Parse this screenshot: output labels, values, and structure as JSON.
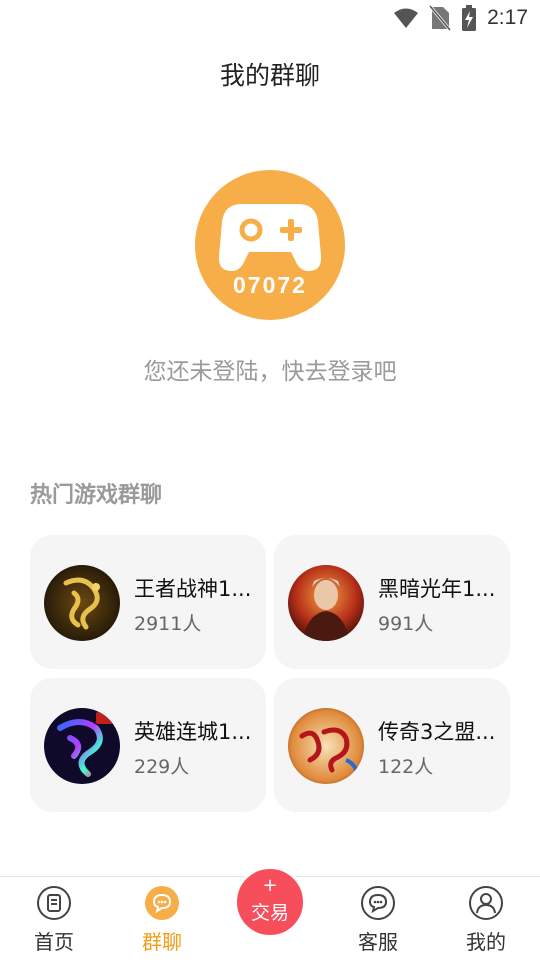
{
  "status_bar": {
    "time": "2:17"
  },
  "header": {
    "title": "我的群聊"
  },
  "logo": {
    "text": "07072",
    "color": "#F7AE49"
  },
  "login_prompt": "您还未登陆，快去登录吧",
  "section": {
    "title": "热门游戏群聊"
  },
  "groups": [
    {
      "name": "王者战神1...",
      "count": "2911人",
      "avatar_icon": "dragon-game-avatar"
    },
    {
      "name": "黑暗光年1...",
      "count": "991人",
      "avatar_icon": "warrior-game-avatar"
    },
    {
      "name": "英雄连城1...",
      "count": "229人",
      "avatar_icon": "dragon-neon-game-avatar"
    },
    {
      "name": "传奇3之盟...",
      "count": "122人",
      "avatar_icon": "legend-game-avatar"
    }
  ],
  "tabs": [
    {
      "label": "首页",
      "icon": "home-icon",
      "active": false
    },
    {
      "label": "群聊",
      "icon": "chat-icon",
      "active": true
    },
    {
      "label": "客服",
      "icon": "service-icon",
      "active": false
    },
    {
      "label": "我的",
      "icon": "profile-icon",
      "active": false
    }
  ],
  "trade_button": {
    "plus": "+",
    "label": "交易",
    "color": "#F64E5A"
  },
  "colors": {
    "accent": "#F39C12",
    "card_bg": "#f5f5f5"
  }
}
